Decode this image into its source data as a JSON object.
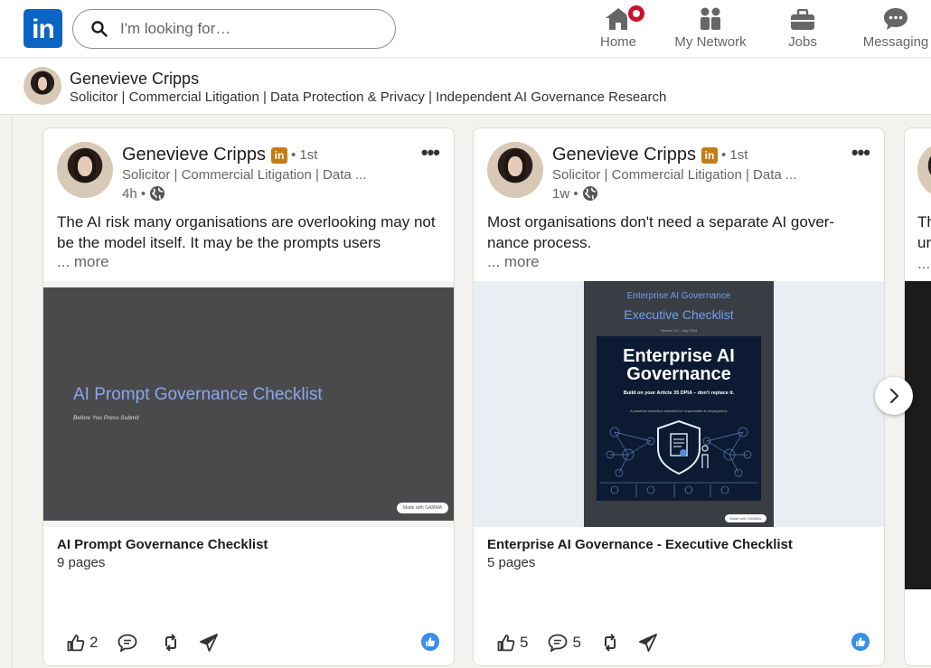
{
  "nav": {
    "logo": "in",
    "search_placeholder": "I'm looking for…",
    "items": [
      {
        "label": "Home",
        "icon": "home-icon"
      },
      {
        "label": "My Network",
        "icon": "people-icon"
      },
      {
        "label": "Jobs",
        "icon": "briefcase-icon"
      },
      {
        "label": "Messaging",
        "icon": "messaging-icon"
      }
    ]
  },
  "profile": {
    "name": "Genevieve Cripps",
    "headline": "Solicitor | Commercial Litigation | Data Protection & Privacy | Independent AI Governance Research"
  },
  "posts": [
    {
      "author": "Genevieve Cripps",
      "premium_badge": "in",
      "degree": "• 1st",
      "headline": "Solicitor | Commercial Litigation | Data ...",
      "time": "4h •",
      "text": "The AI risk many organisations are overlooking may not be the model itself. It may be the prompts users",
      "more": "... more",
      "slide": {
        "title": "AI Prompt Governance Checklist",
        "subtitle": "Before You Press Submit",
        "made_with": "Made with GAMMA"
      },
      "doc_title": "AI Prompt Governance Checklist",
      "doc_pages": "9 pages",
      "likes": "2",
      "comments": ""
    },
    {
      "author": "Genevieve Cripps",
      "premium_badge": "in",
      "degree": "• 1st",
      "headline": "Solicitor | Commercial Litigation | Data ...",
      "time": "1w •",
      "text": "Most organisations don't need a separate AI gover-nance process.",
      "more": "... more",
      "slide": {
        "top_label": "Enterprise AI Governance",
        "top_title": "Executive Checklist",
        "version": "Version 1.0 · July 2024",
        "poster_title": "Enterprise AI Governance",
        "poster_sub": "Build on your Article 35 DPIA – don't replace it.",
        "poster_desc": "A practical executive checklist for responsible AI deployment.",
        "made_with": "Made with GAMMA"
      },
      "doc_title": "Enterprise AI Governance - Executive Checklist",
      "doc_pages": "5 pages",
      "likes": "5",
      "comments": "5"
    }
  ],
  "partial_post": {
    "text_line1": "Th",
    "text_line2": "ur",
    "text_line3": "..."
  },
  "colors": {
    "brand": "#0a66c2",
    "badge_red": "#cb112d",
    "premium_gold": "#c37d16",
    "slide_title": "#8aa6f0"
  }
}
